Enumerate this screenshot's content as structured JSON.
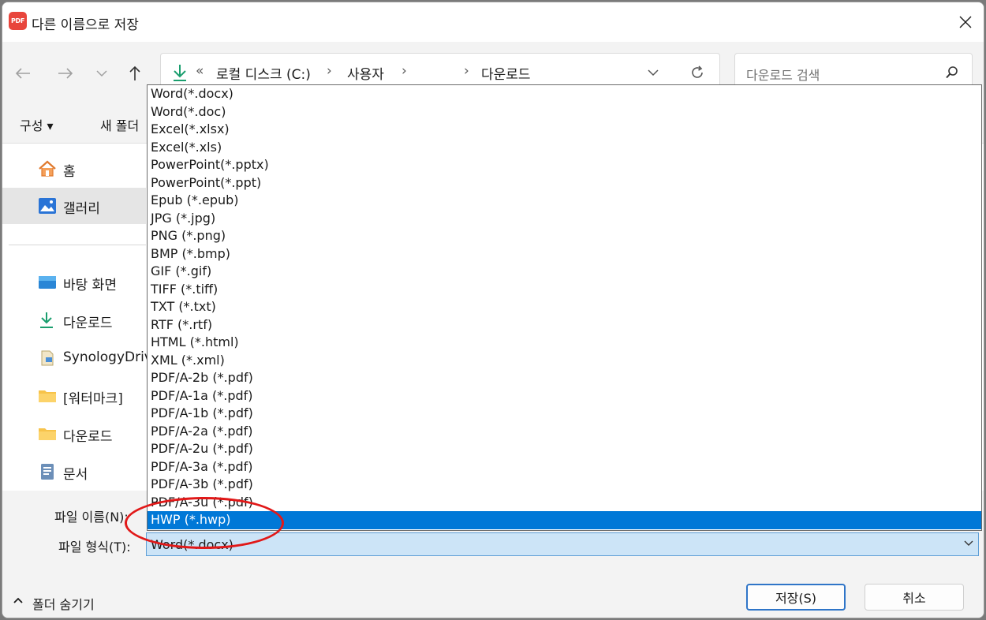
{
  "window": {
    "title": "다른 이름으로 저장",
    "app_icon_text": "PDF"
  },
  "address_bar": {
    "overflow": "«",
    "segments": [
      "로컬 디스크 (C:)",
      "사용자",
      "",
      "다운로드"
    ],
    "separator": "›"
  },
  "search": {
    "placeholder": "다운로드 검색"
  },
  "toolbar": {
    "organize_label": "구성 ▾",
    "new_folder_label": "새 폴더"
  },
  "sidebar": {
    "items": [
      {
        "label": "홈",
        "icon": "home-icon"
      },
      {
        "label": "갤러리",
        "icon": "gallery-icon",
        "selected": true
      },
      {
        "label": "바탕 화면",
        "icon": "desktop-icon"
      },
      {
        "label": "다운로드",
        "icon": "download-icon"
      },
      {
        "label": "SynologyDrive",
        "icon": "synology-drive-icon"
      },
      {
        "label": "[워터마크]",
        "icon": "folder-icon"
      },
      {
        "label": "다운로드",
        "icon": "folder-icon"
      },
      {
        "label": "문서",
        "icon": "documents-icon"
      }
    ]
  },
  "filename": {
    "label": "파일 이름(N):",
    "value": ""
  },
  "filetype": {
    "label": "파일 형식(T):",
    "selected_value": "Word(*.docx)",
    "options": [
      "Word(*.docx)",
      "Word(*.doc)",
      "Excel(*.xlsx)",
      "Excel(*.xls)",
      "PowerPoint(*.pptx)",
      "PowerPoint(*.ppt)",
      "Epub (*.epub)",
      "JPG (*.jpg)",
      "PNG (*.png)",
      "BMP (*.bmp)",
      "GIF (*.gif)",
      "TIFF (*.tiff)",
      "TXT (*.txt)",
      "RTF (*.rtf)",
      "HTML (*.html)",
      "XML (*.xml)",
      "PDF/A-2b (*.pdf)",
      "PDF/A-1a (*.pdf)",
      "PDF/A-1b (*.pdf)",
      "PDF/A-2a (*.pdf)",
      "PDF/A-2u (*.pdf)",
      "PDF/A-3a (*.pdf)",
      "PDF/A-3b (*.pdf)",
      "PDF/A-3u (*.pdf)",
      "HWP (*.hwp)"
    ],
    "highlighted_option": "HWP (*.hwp)"
  },
  "footer": {
    "hide_folders_label": "폴더 숨기기",
    "save_label": "저장(S)",
    "cancel_label": "취소"
  },
  "colors": {
    "accent": "#0078d7",
    "annotation": "#e11818",
    "combo_bg": "#cce4f7"
  }
}
